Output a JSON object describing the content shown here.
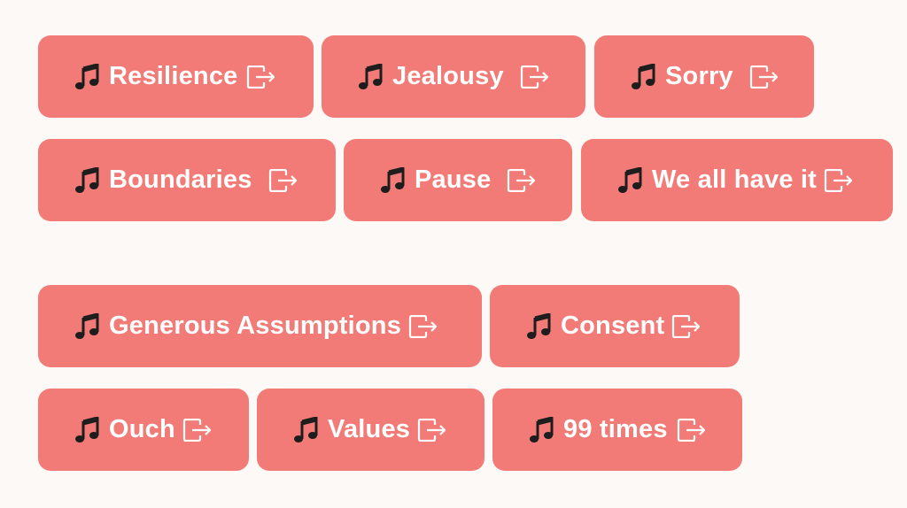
{
  "colors": {
    "background": "#fdf9f6",
    "button": "#f27b77",
    "text": "#ffffff"
  },
  "icons": {
    "leading": "musical-notes-icon",
    "trailing": "exit-icon"
  },
  "buttons": [
    {
      "label": "Resilience"
    },
    {
      "label": "Jealousy"
    },
    {
      "label": "Sorry"
    },
    {
      "label": "Boundaries"
    },
    {
      "label": "Pause"
    },
    {
      "label": "We all have it"
    },
    {
      "label": "Generous Assumptions"
    },
    {
      "label": "Consent"
    },
    {
      "label": "Ouch"
    },
    {
      "label": "Values"
    },
    {
      "label": "99 times"
    }
  ]
}
